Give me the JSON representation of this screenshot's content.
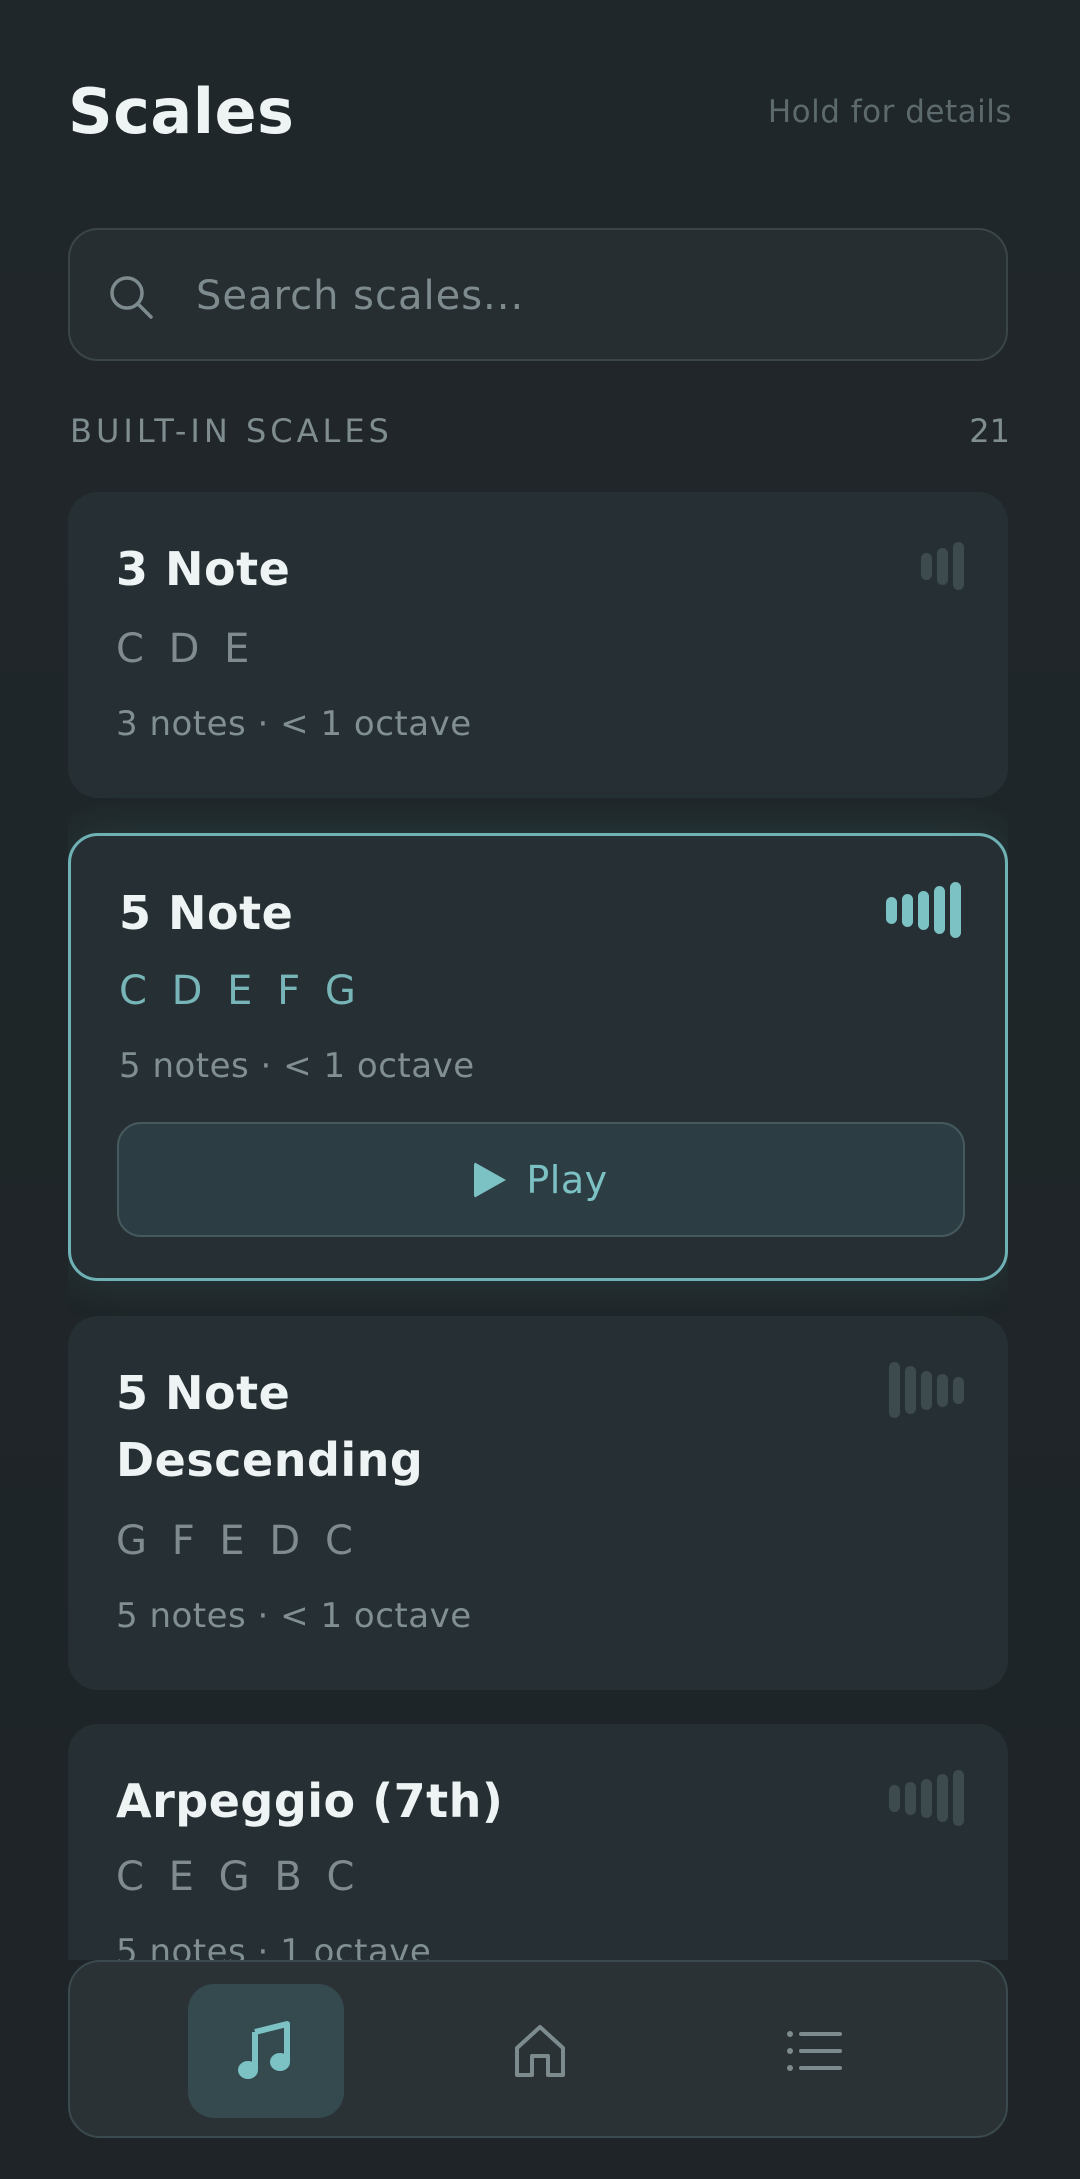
{
  "header": {
    "title": "Scales",
    "hint": "Hold for details"
  },
  "search": {
    "placeholder": "Search scales...",
    "value": ""
  },
  "section": {
    "title": "BUILT-IN SCALES",
    "count": "21"
  },
  "scales": [
    {
      "name": "3 Note",
      "notes": "C D E",
      "meta": "3 notes · < 1 octave",
      "icon": "ascending-bars-icon",
      "bars": [
        0.3,
        0.55,
        0.8
      ],
      "selected": false
    },
    {
      "name": "5 Note",
      "notes": "C D E F G",
      "meta": "5 notes · < 1 octave",
      "icon": "ascending-bars-icon",
      "bars": [
        0.3,
        0.45,
        0.6,
        0.8,
        1.0
      ],
      "selected": true,
      "play_label": "Play"
    },
    {
      "name": "5 Note Descending",
      "notes": "G F E D C",
      "meta": "5 notes · < 1 octave",
      "icon": "descending-bars-icon",
      "bars": [
        1.0,
        0.8,
        0.6,
        0.45,
        0.3
      ],
      "selected": false
    },
    {
      "name": "Arpeggio (7th)",
      "notes": "C E G B C",
      "meta": "5 notes · 1 octave",
      "icon": "ascending-bars-icon",
      "bars": [
        0.3,
        0.45,
        0.6,
        0.8,
        1.0
      ],
      "selected": false
    }
  ],
  "nav": {
    "items": [
      {
        "icon": "music-note-icon",
        "active": true
      },
      {
        "icon": "home-icon",
        "active": false
      },
      {
        "icon": "list-icon",
        "active": false
      }
    ]
  },
  "colors": {
    "background": "#1f2528",
    "card": "#263034",
    "accent": "#7cc1c4",
    "muted_text": "#7f8c90"
  }
}
